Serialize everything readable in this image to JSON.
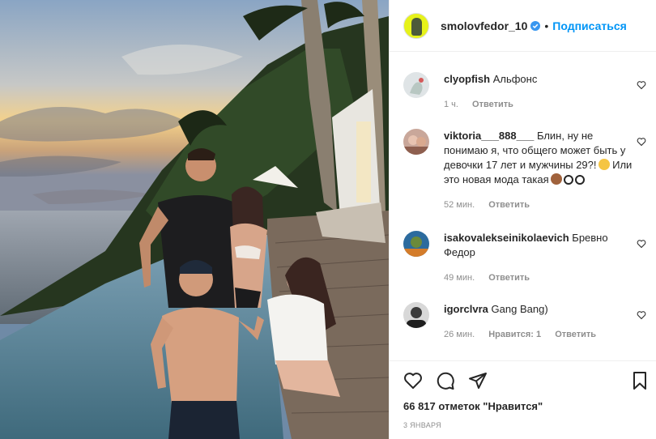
{
  "post": {
    "author": "smolovfedor_10",
    "follow_label": "Подписаться",
    "separator": "•",
    "likes_text": "66 817 отметок \"Нравится\"",
    "date": "3 ЯНВАРЯ"
  },
  "comments": [
    {
      "user": "clyopfish",
      "text": "Альфонс",
      "time": "1 ч.",
      "reply": "Ответить",
      "likes": ""
    },
    {
      "user": "viktoria___888___",
      "text": "Блин, ну не понимаю я, что общего может быть у девочки 17 лет и мужчины 29?!",
      "text2": "Или это новая мода такая",
      "time": "52 мин.",
      "reply": "Ответить",
      "likes": ""
    },
    {
      "user": "isakovalekseinikolaevich",
      "text": "Бревно Федор",
      "time": "49 мин.",
      "reply": "Ответить",
      "likes": ""
    },
    {
      "user": "igorclvra",
      "text": "Gang Bang)",
      "time": "26 мин.",
      "reply": "Ответить",
      "likes": "Нравится: 1"
    }
  ],
  "colors": {
    "accent": "#0095f6",
    "text": "#262626",
    "secondary": "#8e8e8e",
    "verified": "#3897f0"
  },
  "icons": [
    "verified-badge-icon",
    "heart-icon",
    "comment-icon",
    "share-icon",
    "bookmark-icon"
  ]
}
